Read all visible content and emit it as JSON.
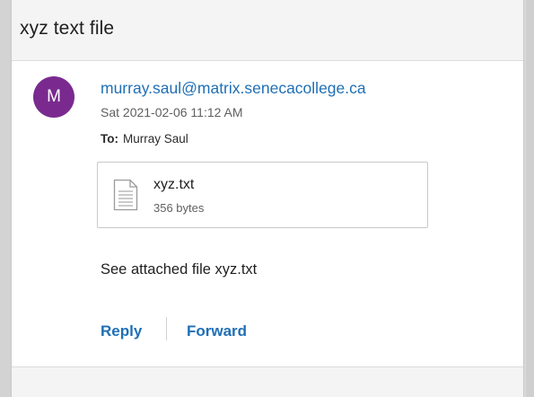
{
  "email": {
    "subject": "xyz text file",
    "sender_initial": "M",
    "sender": "murray.saul@matrix.senecacollege.ca",
    "date": "Sat 2021-02-06 11:12 AM",
    "to_label": "To:",
    "to_name": "Murray Saul",
    "attachment": {
      "icon": "document-icon",
      "name": "xyz.txt",
      "size": "356 bytes"
    },
    "body": "See attached file xyz.txt",
    "actions": {
      "reply": "Reply",
      "forward": "Forward"
    }
  },
  "colors": {
    "avatar_bg": "#7a2a8f",
    "link_blue": "#1f6fb5",
    "header_bg": "#f4f4f4"
  }
}
